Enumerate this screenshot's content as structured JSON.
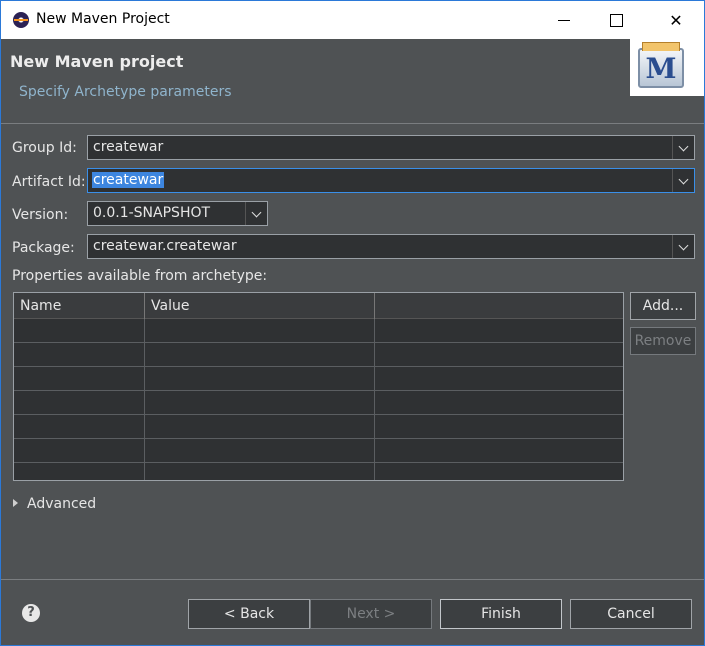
{
  "window": {
    "title": "New Maven Project"
  },
  "header": {
    "title": "New Maven project",
    "subtitle": "Specify Archetype parameters",
    "logo_letter": "M"
  },
  "form": {
    "group_id": {
      "label": "Group Id:",
      "value": "createwar"
    },
    "artifact_id": {
      "label": "Artifact Id:",
      "value": "createwar"
    },
    "version": {
      "label": "Version:",
      "value": "0.0.1-SNAPSHOT"
    },
    "package": {
      "label": "Package:",
      "value": "createwar.createwar"
    }
  },
  "properties": {
    "label": "Properties available from archetype:",
    "columns": [
      "Name",
      "Value",
      ""
    ],
    "rows": [],
    "add_button": "Add...",
    "remove_button": "Remove"
  },
  "advanced": {
    "label": "Advanced"
  },
  "footer": {
    "help_icon": "?",
    "back": "< Back",
    "next": "Next >",
    "finish": "Finish",
    "cancel": "Cancel"
  },
  "icons": [
    "eclipse-app-icon",
    "minimize-icon",
    "maximize-icon",
    "close-icon",
    "maven-logo-icon",
    "chevron-down-icon",
    "expand-triangle-icon",
    "help-icon"
  ],
  "colors": {
    "background": "#4f5254",
    "field": "#2f3133",
    "selection": "#3d86e0",
    "focus_border": "#3a8fe8",
    "subtitle": "#8fb4cc"
  }
}
